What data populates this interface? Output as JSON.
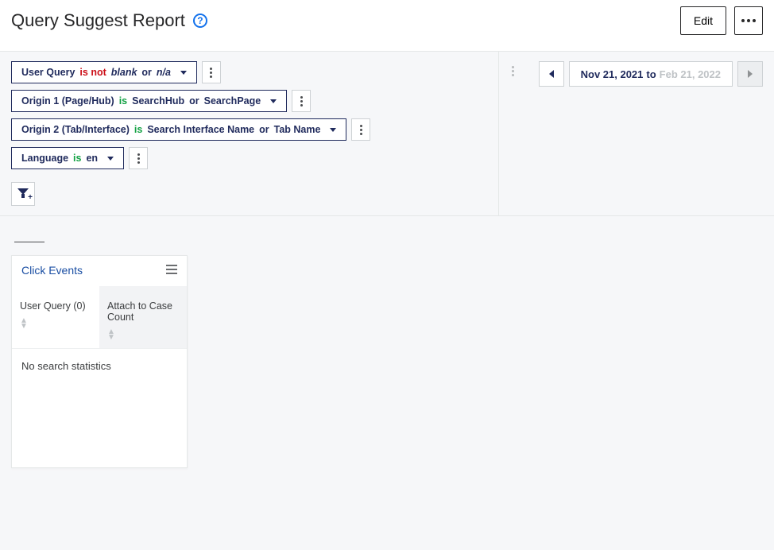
{
  "header": {
    "title": "Query Suggest Report",
    "help_tooltip": "?",
    "edit_label": "Edit"
  },
  "filters": [
    {
      "field": "User Query",
      "negated": true,
      "op_prefix": "is",
      "op_neg": "not",
      "values": [
        "blank",
        "n/a"
      ],
      "value_style": "italic",
      "conj": "or"
    },
    {
      "field": "Origin 1 (Page/Hub)",
      "negated": false,
      "op_prefix": "is",
      "values": [
        "SearchHub",
        "SearchPage"
      ],
      "value_style": "plain",
      "conj": "or"
    },
    {
      "field": "Origin 2 (Tab/Interface)",
      "negated": false,
      "op_prefix": "is",
      "values": [
        "Search Interface Name",
        "Tab Name"
      ],
      "value_style": "plain",
      "conj": "or"
    },
    {
      "field": "Language",
      "negated": false,
      "op_prefix": "is",
      "values": [
        "en"
      ],
      "value_style": "plain",
      "conj": ""
    }
  ],
  "date_range": {
    "from": "Nov 21, 2021",
    "to_label": "to",
    "to": "Feb 21, 2022",
    "prev_enabled": true,
    "next_enabled": false
  },
  "card": {
    "title": "Click Events",
    "columns": [
      "User Query (0)",
      "Attach to Case Count"
    ],
    "empty_message": "No search statistics"
  }
}
